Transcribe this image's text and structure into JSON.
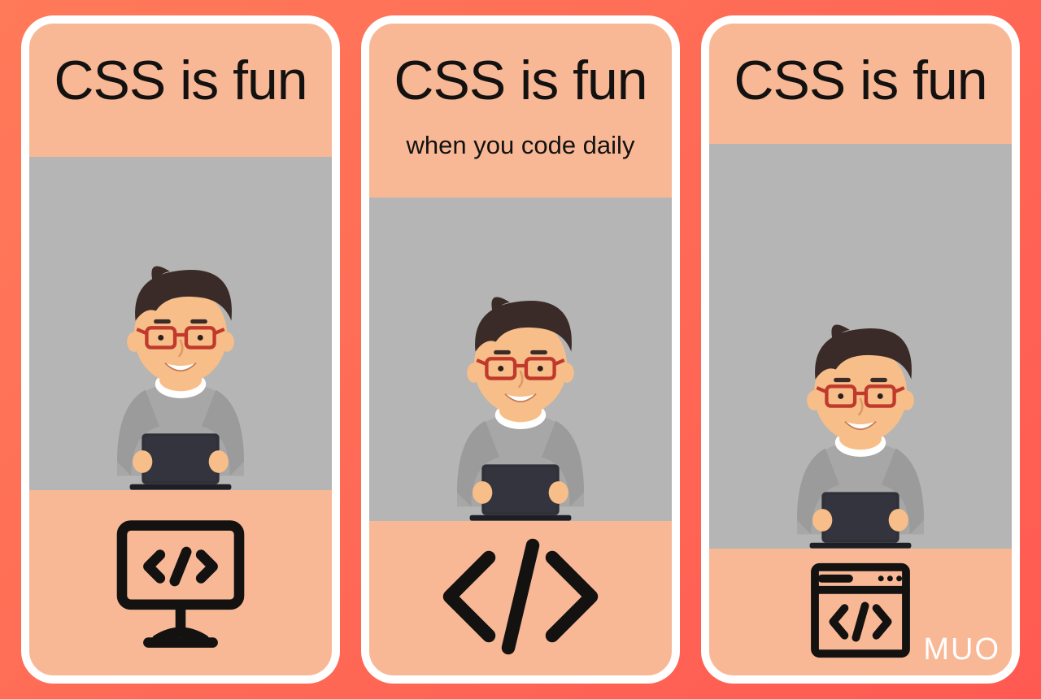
{
  "cards": [
    {
      "title": "CSS is fun",
      "subtitle": "",
      "footer_icon": "code-monitor-icon"
    },
    {
      "title": "CSS is fun",
      "subtitle": "when you code daily",
      "footer_icon": "code-brackets-icon"
    },
    {
      "title": "CSS is fun",
      "subtitle": "",
      "footer_icon": "code-window-icon"
    }
  ],
  "watermark": "MUO",
  "colors": {
    "card_bg": "#f8b896",
    "illus_bg": "#b4b5b4",
    "border": "#ffffff",
    "text": "#131211"
  }
}
